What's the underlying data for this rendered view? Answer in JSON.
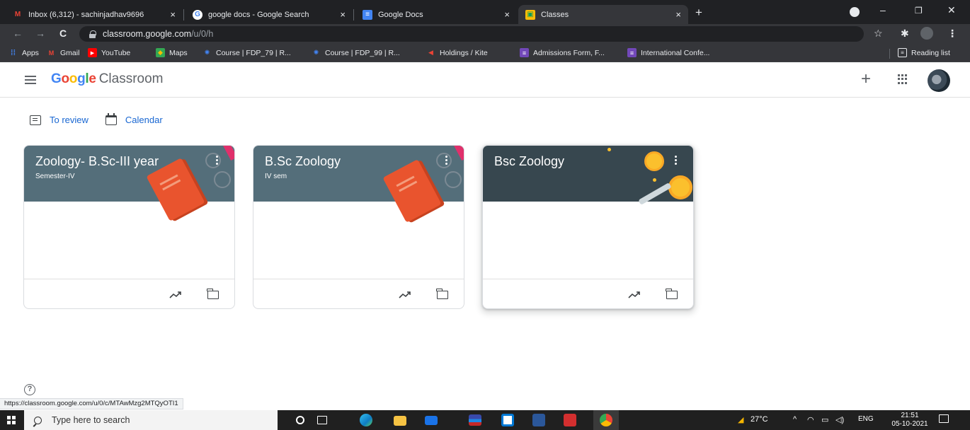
{
  "browser": {
    "tabs": [
      {
        "title": "Inbox (6,312) - sachinjadhav9696",
        "close": "×",
        "favicon": "M",
        "active": false
      },
      {
        "title": "google docs - Google Search",
        "close": "×",
        "favicon": "G",
        "active": false
      },
      {
        "title": "Google Docs",
        "close": "×",
        "favicon": "≡",
        "active": false
      },
      {
        "title": "Classes",
        "close": "×",
        "favicon": "▣",
        "active": true
      }
    ],
    "new_tab": "+",
    "window_controls": {
      "minimize": "–",
      "maximize": "❐",
      "close": "✕"
    },
    "nav": {
      "back": "←",
      "forward": "→",
      "reload": "C"
    },
    "url_host": "classroom.google.com",
    "url_path": "/u/0/h",
    "toolbar_icons": {
      "star": "☆",
      "extensions": "✱",
      "menu": "⋮"
    },
    "bookmarks": [
      {
        "label": "Apps",
        "icon": "apps-grid-icon"
      },
      {
        "label": "Gmail",
        "icon": "gmail-icon"
      },
      {
        "label": "YouTube",
        "icon": "youtube-icon"
      },
      {
        "label": "Maps",
        "icon": "maps-icon"
      },
      {
        "label": "Course | FDP_79 | R...",
        "icon": "course-icon"
      },
      {
        "label": "Course | FDP_99 | R...",
        "icon": "course-icon"
      },
      {
        "label": "Holdings / Kite",
        "icon": "kite-icon"
      },
      {
        "label": "Admissions Form, F...",
        "icon": "forms-icon"
      },
      {
        "label": "International Confe...",
        "icon": "forms-icon"
      }
    ],
    "reading_list": "Reading list",
    "status_url": "https://classroom.google.com/u/0/c/MTAwMzg2MTQyOTI1"
  },
  "classroom": {
    "brand_g": [
      "G",
      "o",
      "o",
      "g",
      "l",
      "e"
    ],
    "brand_product": "Classroom",
    "header_plus": "+",
    "actions": {
      "to_review": "To review",
      "calendar": "Calendar"
    },
    "cards": [
      {
        "title": "Zoology- B.Sc-III year",
        "subtitle": "Semester-IV",
        "banner_color": "#546e7a"
      },
      {
        "title": "B.Sc Zoology",
        "subtitle": "IV sem",
        "banner_color": "#546e7a"
      },
      {
        "title": "Bsc Zoology",
        "subtitle": "",
        "banner_color": "#37474f"
      }
    ],
    "help": "?"
  },
  "taskbar": {
    "search_placeholder": "Type here to search",
    "weather": "27°C",
    "tray_up": "^",
    "language": "ENG",
    "time": "21:51",
    "date": "05-10-2021"
  },
  "colors": {
    "tab_bg": "#202124",
    "toolbar_bg": "#35363a",
    "link_blue": "#1967d2",
    "book_orange": "#e9542e"
  }
}
